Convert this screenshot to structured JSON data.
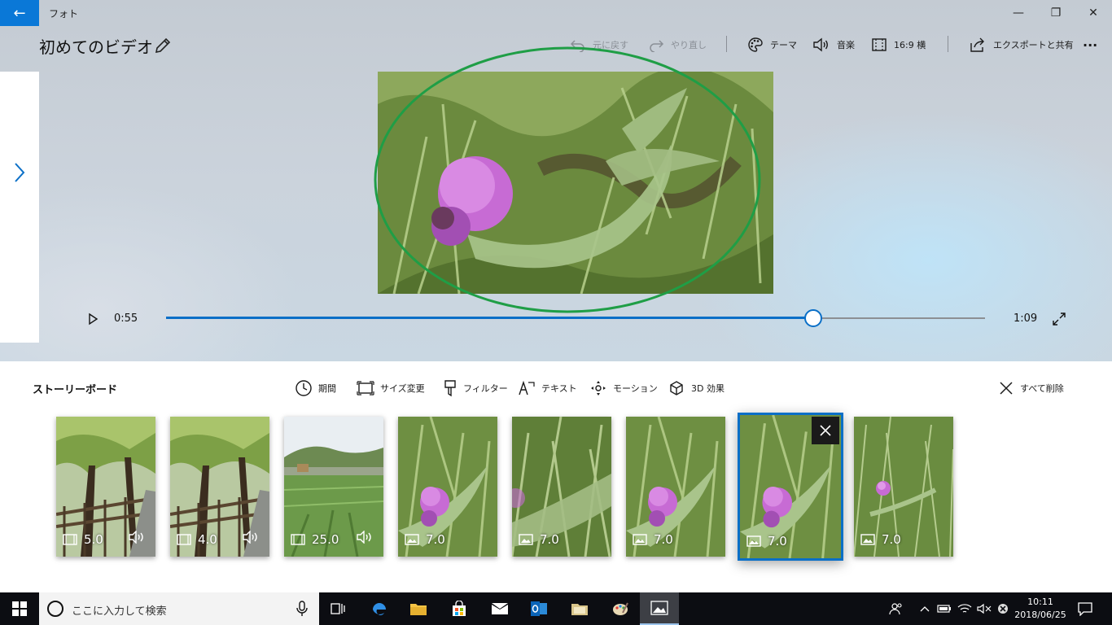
{
  "window": {
    "app_name": "フォト",
    "back_glyph": "←",
    "minimize_glyph": "—",
    "maximize_glyph": "❐",
    "close_glyph": "✕"
  },
  "project": {
    "title": "初めてのビデオ"
  },
  "toolbar": {
    "undo_label": "元に戻す",
    "redo_label": "やり直し",
    "theme_label": "テーマ",
    "music_label": "音楽",
    "aspect_label": "16:9 横",
    "export_label": "エクスポートと共有",
    "more_glyph": "···"
  },
  "player": {
    "current_time": "0:55",
    "total_time": "1:09",
    "progress": 0.79
  },
  "storyboard": {
    "title": "ストーリーボード",
    "tools": {
      "duration_label": "期間",
      "resize_label": "サイズ変更",
      "filter_label": "フィルター",
      "text_label": "テキスト",
      "motion_label": "モーション",
      "effects3d_label": "3D 効果",
      "delete_all_label": "すべて削除"
    },
    "clips": [
      {
        "type": "video",
        "duration": "5.0",
        "audio": true,
        "scene": "tree-path"
      },
      {
        "type": "video",
        "duration": "4.0",
        "audio": true,
        "scene": "tree-path"
      },
      {
        "type": "video",
        "duration": "25.0",
        "audio": true,
        "scene": "field"
      },
      {
        "type": "image",
        "duration": "7.0",
        "audio": false,
        "scene": "thistle"
      },
      {
        "type": "image",
        "duration": "7.0",
        "audio": false,
        "scene": "grass"
      },
      {
        "type": "image",
        "duration": "7.0",
        "audio": false,
        "scene": "thistle"
      },
      {
        "type": "image",
        "duration": "7.0",
        "audio": false,
        "scene": "thistle",
        "selected": true
      },
      {
        "type": "image",
        "duration": "7.0",
        "audio": false,
        "scene": "grass-small-flower"
      }
    ]
  },
  "taskbar": {
    "search_placeholder": "ここに入力して検索",
    "time": "10:11",
    "date": "2018/06/25"
  },
  "colors": {
    "accent": "#0a78d7",
    "annotation": "#1f9e46",
    "taskbar": "#0c0d12"
  }
}
